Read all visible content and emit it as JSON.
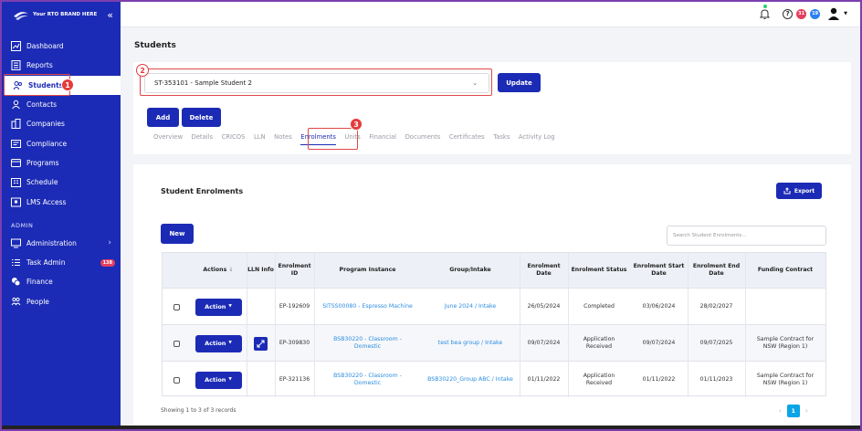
{
  "brand": {
    "name": "Your RTO BRAND HERE",
    "collapse_icon": "double-chevron-left-icon"
  },
  "sidebar": {
    "items": [
      {
        "label": "Dashboard",
        "icon": "chart-icon"
      },
      {
        "label": "Reports",
        "icon": "report-icon"
      },
      {
        "label": "Students",
        "icon": "students-icon",
        "active": true
      },
      {
        "label": "Contacts",
        "icon": "contacts-icon"
      },
      {
        "label": "Companies",
        "icon": "companies-icon"
      },
      {
        "label": "Compliance",
        "icon": "compliance-icon"
      },
      {
        "label": "Programs",
        "icon": "programs-icon"
      },
      {
        "label": "Schedule",
        "icon": "schedule-icon"
      },
      {
        "label": "LMS Access",
        "icon": "lms-icon"
      }
    ],
    "admin_section": "ADMIN",
    "admin_items": [
      {
        "label": "Administration",
        "icon": "admin-icon"
      },
      {
        "label": "Task Admin",
        "icon": "tasks-icon",
        "badge": "138"
      },
      {
        "label": "Finance",
        "icon": "finance-icon"
      },
      {
        "label": "People",
        "icon": "people-icon"
      }
    ]
  },
  "topbar": {
    "badge1": "31",
    "badge2": "19"
  },
  "page_title": "Students",
  "student_select": {
    "value": "ST-353101 - Sample Student 2"
  },
  "buttons": {
    "update": "Update",
    "add": "Add",
    "delete": "Delete",
    "new": "New",
    "export": "Export",
    "action": "Action"
  },
  "tabs": [
    "Overview",
    "Details",
    "CRICOS",
    "LLN",
    "Notes",
    "Enrolments",
    "Units",
    "Financial",
    "Documents",
    "Certificates",
    "Tasks",
    "Activity Log"
  ],
  "active_tab": "Enrolments",
  "section_title": "Student Enrolments",
  "search": {
    "placeholder": "Search Student Enrolments..."
  },
  "table": {
    "headers": {
      "actions": "Actions",
      "lln": "LLN Info",
      "enrolment_id": "Enrolment ID",
      "program": "Program Instance",
      "group": "Group/Intake",
      "enrol_date": "Enrolment Date",
      "status": "Enrolment Status",
      "start": "Enrolment Start Date",
      "end": "Enrolment End Date",
      "funding": "Funding Contract"
    },
    "rows": [
      {
        "id": "EP-192609",
        "program": "SITSS00080 - Espresso Machine",
        "group": "June 2024 / Intake",
        "enrol_date": "26/05/2024",
        "status": "Completed",
        "start": "03/06/2024",
        "end": "28/02/2027",
        "funding": ""
      },
      {
        "id": "EP-309830",
        "program": "BSB30220 - Classroom - Domestic",
        "group": "test bea group / Intake",
        "enrol_date": "09/07/2024",
        "status": "Application Received",
        "start": "09/07/2024",
        "end": "09/07/2025",
        "funding": "Sample Contract for NSW (Region 1)"
      },
      {
        "id": "EP-321136",
        "program": "BSB30220 - Classroom - Domestic",
        "group": "BSB30220_Group ABC / Intake",
        "enrol_date": "01/11/2022",
        "status": "Application Received",
        "start": "01/11/2022",
        "end": "01/11/2023",
        "funding": "Sample Contract for NSW (Region 1)"
      }
    ]
  },
  "footer": {
    "records": "Showing 1 to 3 of 3 records",
    "page": "1"
  },
  "annotations": {
    "n1": "1",
    "n2": "2",
    "n3": "3"
  },
  "colors": {
    "primary": "#1c2bb5",
    "highlight": "#e04848",
    "link": "#2b8de0"
  }
}
